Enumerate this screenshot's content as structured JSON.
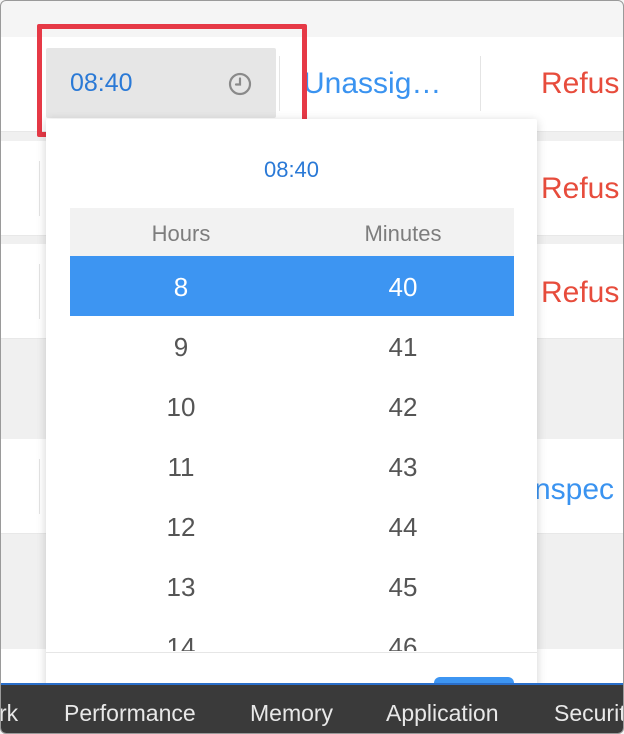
{
  "table": {
    "rows": [
      {
        "status": "Unassig…",
        "action": "Refus"
      },
      {
        "action": "Refus"
      },
      {
        "action": "Refus"
      },
      {
        "action": "nspec"
      }
    ]
  },
  "time_field": {
    "value": "08:40",
    "icon": "clock-icon"
  },
  "picker": {
    "header": "08:40",
    "columns": {
      "hours": "Hours",
      "minutes": "Minutes"
    },
    "items": [
      {
        "hour": "8",
        "minute": "40",
        "selected": true
      },
      {
        "hour": "9",
        "minute": "41"
      },
      {
        "hour": "10",
        "minute": "42"
      },
      {
        "hour": "11",
        "minute": "43"
      },
      {
        "hour": "12",
        "minute": "44"
      },
      {
        "hour": "13",
        "minute": "45"
      },
      {
        "hour": "14",
        "minute": "46"
      }
    ]
  },
  "devtools": {
    "tabs": [
      "rk",
      "Performance",
      "Memory",
      "Application",
      "Securit"
    ]
  },
  "colors": {
    "accent": "#3d95f2",
    "time_text": "#2a79d6",
    "refuse": "#e74c3c",
    "highlight": "#e63946"
  }
}
